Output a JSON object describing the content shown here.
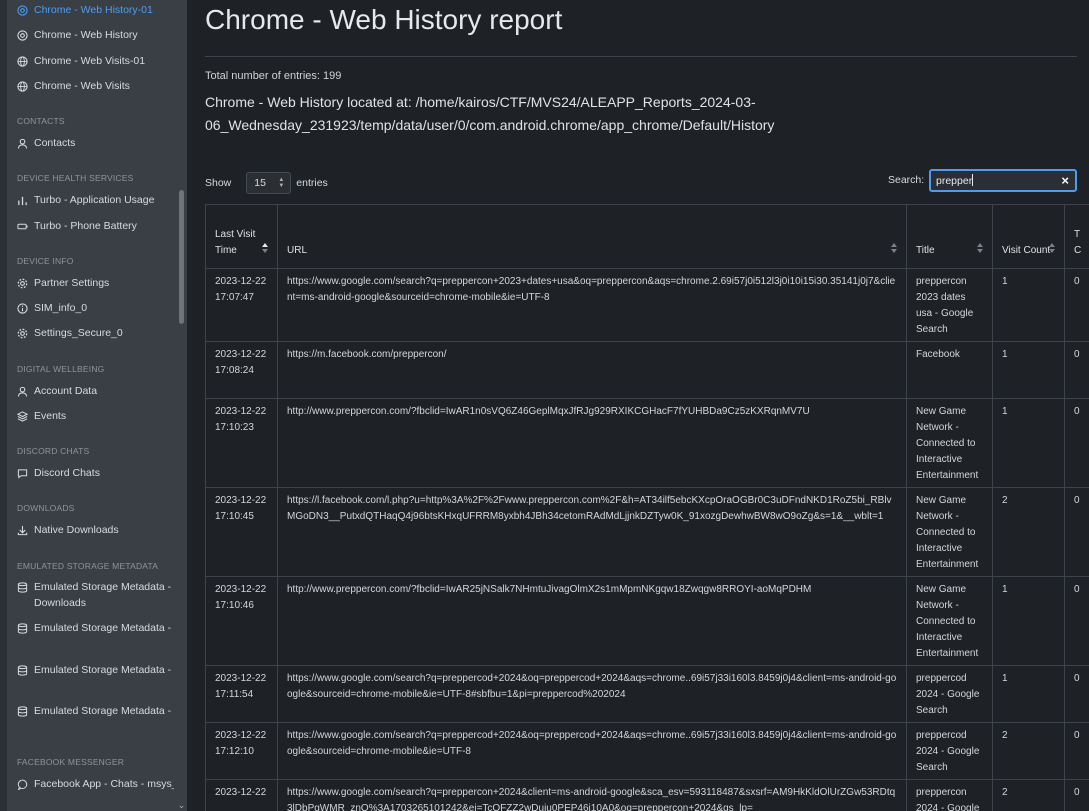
{
  "sidebar": {
    "items_top": [
      {
        "label": "Chrome - Web History-01",
        "icon": "chrome-icon"
      },
      {
        "label": "Chrome - Web History",
        "icon": "chrome-icon"
      },
      {
        "label": "Chrome - Web Visits-01",
        "icon": "globe-icon"
      },
      {
        "label": "Chrome - Web Visits",
        "icon": "globe-icon"
      }
    ],
    "sections": [
      {
        "title": "CONTACTS",
        "items": [
          {
            "label": "Contacts",
            "icon": "user-icon"
          }
        ]
      },
      {
        "title": "DEVICE HEALTH SERVICES",
        "items": [
          {
            "label": "Turbo - Application Usage",
            "icon": "bar-chart-icon"
          },
          {
            "label": "Turbo - Phone Battery",
            "icon": "battery-icon"
          }
        ]
      },
      {
        "title": "DEVICE INFO",
        "items": [
          {
            "label": "Partner Settings",
            "icon": "gear-icon"
          },
          {
            "label": "SIM_info_0",
            "icon": "info-icon"
          },
          {
            "label": "Settings_Secure_0",
            "icon": "gear-icon"
          }
        ]
      },
      {
        "title": "DIGITAL WELLBEING",
        "items": [
          {
            "label": "Account Data",
            "icon": "user-icon"
          },
          {
            "label": "Events",
            "icon": "layers-icon"
          }
        ]
      },
      {
        "title": "DISCORD CHATS",
        "items": [
          {
            "label": "Discord Chats",
            "icon": "message-icon"
          }
        ]
      },
      {
        "title": "DOWNLOADS",
        "items": [
          {
            "label": "Native Downloads",
            "icon": "download-icon"
          }
        ]
      },
      {
        "title": "EMULATED STORAGE METADATA",
        "items": [
          {
            "label": "Emulated Storage Metadata - Downloads",
            "icon": "database-icon"
          },
          {
            "label": "Emulated Storage Metadata - F",
            "icon": "database-icon"
          },
          {
            "label": "Emulated Storage Metadata - In",
            "icon": "database-icon"
          },
          {
            "label": "Emulated Storage Metadata - V",
            "icon": "database-icon"
          }
        ]
      },
      {
        "title": "FACEBOOK MESSENGER",
        "items": [
          {
            "label": "Facebook App - Chats - msys_d",
            "icon": "message-icon"
          }
        ]
      }
    ]
  },
  "main": {
    "title": "Chrome - Web History report",
    "total": "Total number of entries: 199",
    "location": "Chrome - Web History located at: /home/kairos/CTF/MVS24/ALEAPP_Reports_2024-03-06_Wednesday_231923/temp/data/user/0/com.android.chrome/app_chrome/Default/History",
    "show_label": "Show",
    "show_value": "15",
    "entries_label": "entries",
    "search_label": "Search:",
    "search_value": "prepper"
  },
  "table": {
    "headers": [
      "Last Visit Time",
      "URL",
      "Title",
      "Visit Count",
      "T C"
    ],
    "rows": [
      {
        "time": "2023-12-22 17:07:47",
        "url": "https://www.google.com/search?q=preppercon+2023+dates+usa&oq=preppercon&aqs=chrome.2.69i57j0i512l3j0i10i15i30.35141j0j7&client=ms-android-google&sourceid=chrome-mobile&ie=UTF-8",
        "title": "preppercon 2023 dates usa - Google Search",
        "count": "1",
        "t": "0"
      },
      {
        "time": "2023-12-22 17:08:24",
        "url": "https://m.facebook.com/preppercon/",
        "title": "Facebook",
        "count": "1",
        "t": "0"
      },
      {
        "time": "2023-12-22 17:10:23",
        "url": "http://www.preppercon.com/?fbclid=IwAR1n0sVQ6Z46GeplMqxJfRJg929RXIKCGHacF7fYUHBDa9Cz5zKXRqnMV7U",
        "title": "New Game Network - Connected to Interactive Entertainment",
        "count": "1",
        "t": "0"
      },
      {
        "time": "2023-12-22 17:10:45",
        "url": "https://l.facebook.com/l.php?u=http%3A%2F%2Fwww.preppercon.com%2F&h=AT34ilf5ebcKXcpOraOGBr0C3uDFndNKD1RoZ5bi_RBlvMGoDN3__PutxdQTHaqQ4j96btsKHxqUFRRM8yxbh4JBh34cetomRAdMdLjjnkDZTyw0K_91xozgDewhwBW8wO9oZg&s=1&__wblt=1",
        "title": "New Game Network - Connected to Interactive Entertainment",
        "count": "2",
        "t": "0"
      },
      {
        "time": "2023-12-22 17:10:46",
        "url": "http://www.preppercon.com/?fbclid=IwAR25jNSalk7NHmtuJivagOlmX2s1mMpmNKgqw18Zwqgw8RROYI-aoMqPDHM",
        "title": "New Game Network - Connected to Interactive Entertainment",
        "count": "1",
        "t": "0"
      },
      {
        "time": "2023-12-22 17:11:54",
        "url": "https://www.google.com/search?q=preppercod+2024&oq=preppercod+2024&aqs=chrome..69i57j33i160l3.8459j0j4&client=ms-android-google&sourceid=chrome-mobile&ie=UTF-8#sbfbu=1&pi=preppercod%202024",
        "title": "preppercod 2024 - Google Search",
        "count": "1",
        "t": "0"
      },
      {
        "time": "2023-12-22 17:12:10",
        "url": "https://www.google.com/search?q=preppercod+2024&oq=preppercod+2024&aqs=chrome..69i57j33i160l3.8459j0j4&client=ms-android-google&sourceid=chrome-mobile&ie=UTF-8",
        "title": "preppercod 2024 - Google Search",
        "count": "2",
        "t": "0"
      },
      {
        "time": "2023-12-22",
        "url": "https://www.google.com/search?q=preppercon+2024&client=ms-android-google&sca_esv=593118487&sxsrf=AM9HkKldOlUrZGw53RDtq3lDbPgWMR_znQ%3A1703265101242&ei=TcOFZZ2wDuju0PEP46i10A0&oq=preppercon+2024&gs_lp=",
        "title": "preppercon 2024 - Google",
        "count": "2",
        "t": "0"
      }
    ]
  },
  "colors": {
    "accent": "#4e9cf0",
    "background": "#1e2125",
    "sidebar": "#3a3f45"
  }
}
